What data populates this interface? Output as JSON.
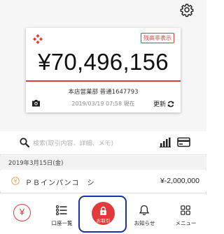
{
  "header": {
    "settings_icon": "gear-icon"
  },
  "balance_card": {
    "hide_balance_label": "残高非表示",
    "balance": "¥70,496,156",
    "account": "本店営業部 普通1647793",
    "timestamp": "2019/03/19 07:58 現在",
    "refresh_label": "更新",
    "accent_color": "#e23a3a"
  },
  "search": {
    "placeholder": "検索(取引内容、詳細、メモ)"
  },
  "transactions": {
    "date_header": "2019年3月15日(金)",
    "items": [
      {
        "name": "ＰＢインパンコ　シ",
        "amount": "¥-2,000,000"
      }
    ]
  },
  "tabbar": {
    "tabs": [
      {
        "label": "",
        "icon": "yen-icon"
      },
      {
        "label": "口座一覧",
        "icon": "list-icon"
      },
      {
        "label": "お取引",
        "icon": "lock-icon",
        "selected": true
      },
      {
        "label": "お知らせ",
        "icon": "bell-icon"
      },
      {
        "label": "メニュー",
        "icon": "grid-icon"
      }
    ]
  }
}
